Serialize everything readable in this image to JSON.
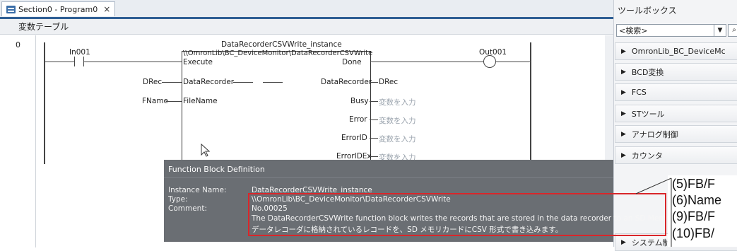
{
  "editor": {
    "tab_label": "Section0 - Program0",
    "tab_close": "×",
    "var_table_label": "変数テーブル",
    "rung_number": "0"
  },
  "ladder": {
    "contact_label": "In001",
    "fb_instance": "DataRecorderCSVWrite_instance",
    "fb_type_path": "\\\\OmronLib\\BC_DeviceMonitor\\DataRecorderCSVWrite",
    "pins_in": [
      {
        "name": "Execute",
        "arg": ""
      },
      {
        "name": "DataRecorder",
        "arg": "DRec"
      },
      {
        "name": "FileName",
        "arg": "FName"
      }
    ],
    "pins_out": [
      {
        "name": "Done",
        "arg": ""
      },
      {
        "name": "DataRecorder",
        "arg": "DRec"
      },
      {
        "name": "Busy",
        "arg": "変数を入力"
      },
      {
        "name": "Error",
        "arg": "変数を入力"
      },
      {
        "name": "ErrorID",
        "arg": "変数を入力"
      },
      {
        "name": "ErrorIDEx",
        "arg": "変数を入力"
      }
    ],
    "coil_label": "Out001"
  },
  "toolbox": {
    "title": "ツールボックス",
    "search_value": "<検索>",
    "drop_icon": "▼",
    "find_icon": "⌕",
    "items": [
      "OmronLib_BC_DeviceMc",
      "BCD変換",
      "FCS",
      "STツール",
      "アナログ制御",
      "カウンタ",
      "システム制"
    ]
  },
  "tooltip": {
    "title": "Function Block Definition",
    "instance_label": "Instance Name:",
    "instance_value": "DataRecorderCSVWrite_instance",
    "type_label": "Type:",
    "type_value": "\\\\OmronLib\\BC_DeviceMonitor\\DataRecorderCSVWrite",
    "comment_label": "Comment:",
    "comment_no": "No.00025",
    "comment_en": "The DataRecorderCSVWrite function block writes the records that are stored in the data recorder to an SD Memo",
    "comment_ja": "データレコーダに格納されているレコードを、SD メモリカードにCSV 形式で書き込みます。"
  },
  "callouts": [
    "(5)FB/F",
    "(6)Name",
    "(9)FB/F",
    "(10)FB/"
  ],
  "colors": {
    "accent": "#2f5f95",
    "highlight": "#d9262a",
    "tooltip_bg": "#6a6e73"
  }
}
